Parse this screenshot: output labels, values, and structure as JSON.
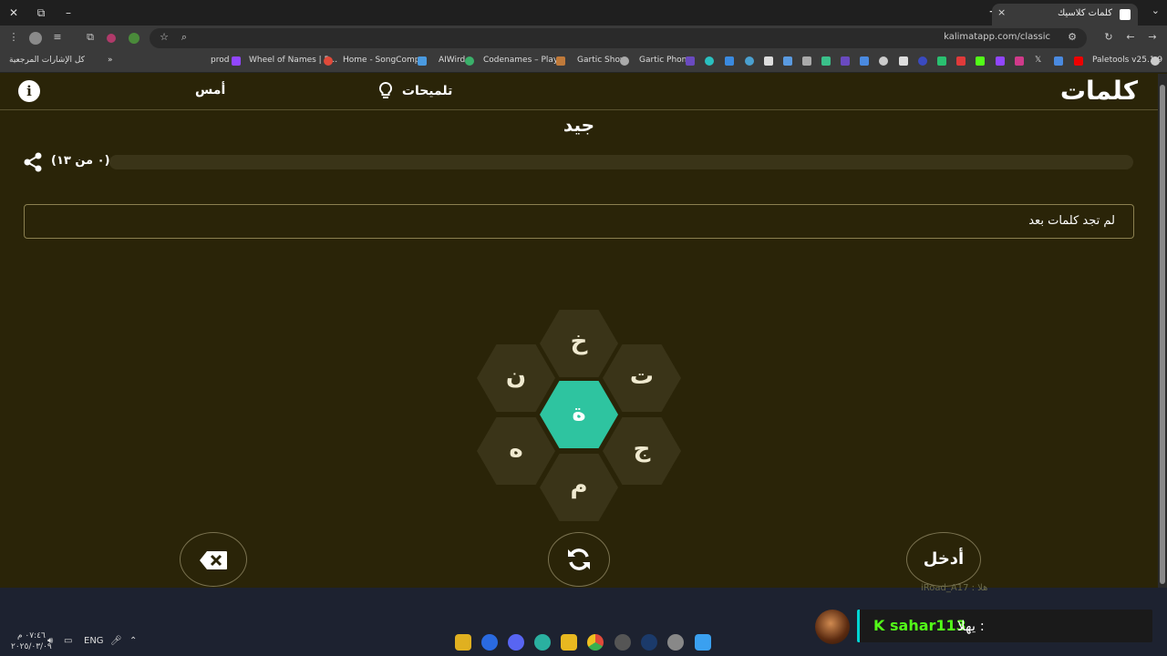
{
  "browser": {
    "tab_title": "كلمات كلاسيك",
    "url": "kalimatapp.com/classic",
    "new_tab": "+",
    "tab_close": "×",
    "window_close": "✕",
    "window_max": "⧉",
    "window_min": "–",
    "bookmarks": {
      "all_bookmarks": "كل الإشارات المرجعية",
      "more": "»",
      "items": [
        "prod",
        "Wheel of Names | R...",
        "Home - SongComp...",
        "AIWird",
        "Codenames – Play...",
        "Gartic Show",
        "Gartic Phone",
        "Paletools v25.1.9"
      ]
    }
  },
  "app": {
    "logo": "كلمات",
    "hints_label": "تلميحات",
    "yesterday_label": "أمس",
    "info_label": "i",
    "rank": "جيد",
    "score": "(٠ من ١٣)",
    "progress_fraction": 0,
    "found_words_text": "لم تجد كلمات بعد",
    "letters": {
      "center": "ة",
      "top": "خ",
      "top_right": "ت",
      "bottom_right": "ج",
      "bottom": "م",
      "bottom_left": "ه",
      "top_left": "ن"
    },
    "enter_label": "أدخل",
    "accent_color": "#2ec4a0",
    "background_color": "#2a2408"
  },
  "overlay": {
    "ghost_text": "iRoad_A17 : هلا",
    "chat_user": "sahar113",
    "chat_message": ": يهلا"
  },
  "taskbar": {
    "lang": "ENG",
    "time": "٠٧:٤٦ م",
    "date": "٢٠٢٥/٠٣/٠٩"
  }
}
